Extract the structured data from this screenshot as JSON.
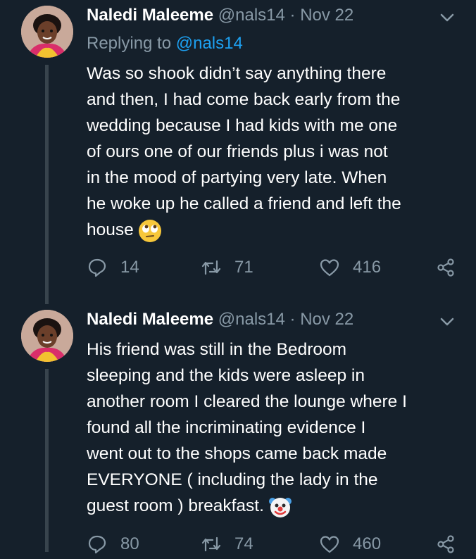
{
  "tweets": [
    {
      "author_name": "Naledi Maleeme",
      "handle": "@nals14",
      "separator": "·",
      "date": "Nov 22",
      "replying_prefix": "Replying to",
      "replying_to": "@nals14",
      "lines": [
        "Was so shook didn’t say anything there",
        "and then, I had come back early from the",
        "wedding because I had kids with me one",
        "of ours one of our friends plus i was not",
        "in the mood of partying very late. When",
        "he woke up he called a friend and left the",
        "house"
      ],
      "emoji": "face-with-rolling-eyes",
      "replies": "14",
      "retweets": "71",
      "likes": "416"
    },
    {
      "author_name": "Naledi Maleeme",
      "handle": "@nals14",
      "separator": "·",
      "date": "Nov 22",
      "lines": [
        "His friend was still in the Bedroom",
        "sleeping and the kids were asleep in",
        "another room I cleared the lounge where I",
        "found all the incriminating evidence I",
        "went out to the shops came back made",
        "EVERYONE ( including the lady in the",
        "guest room ) breakfast."
      ],
      "emoji": "clown-face",
      "replies": "80",
      "retweets": "74",
      "likes": "460"
    }
  ],
  "colors": {
    "background": "#15202b",
    "secondary_text": "#8899a6",
    "mention": "#1da1f2",
    "thread_line": "#38444d"
  }
}
